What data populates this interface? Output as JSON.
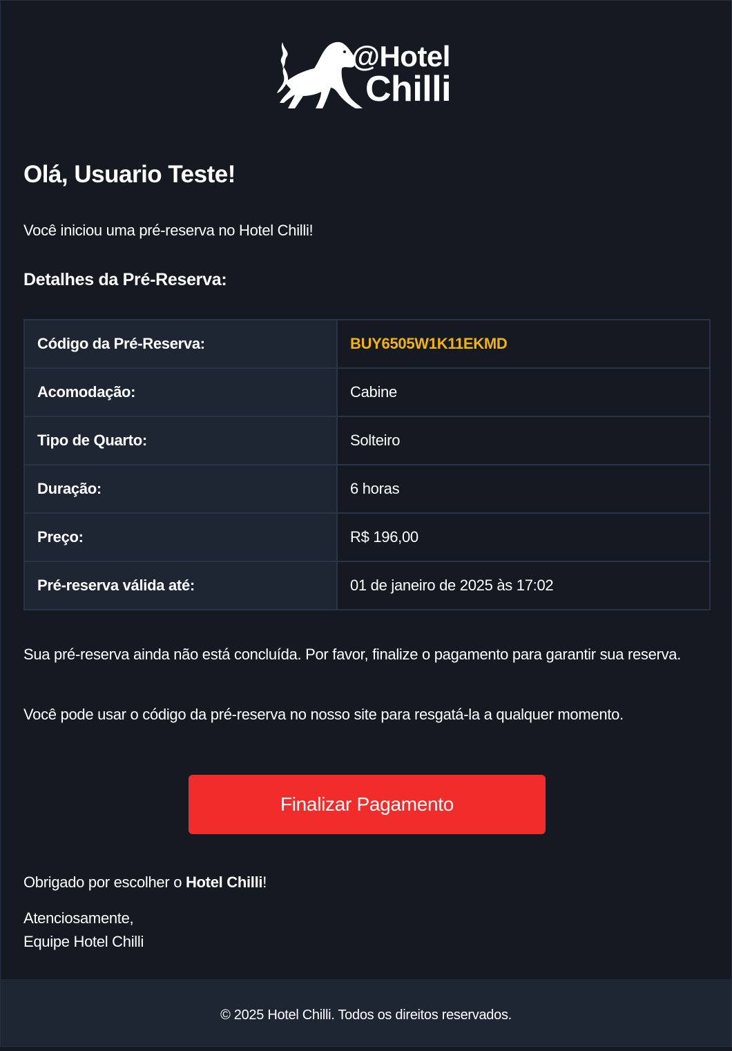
{
  "brand": {
    "logo_line1": "@Hotel",
    "logo_line2": "Chilli"
  },
  "greeting": "Olá, Usuario Teste!",
  "intro": "Você iniciou uma pré-reserva no Hotel Chilli!",
  "details_title": "Detalhes da Pré-Reserva:",
  "details": [
    {
      "label": "Código da Pré-Reserva:",
      "value": "BUY6505W1K11EKMD"
    },
    {
      "label": "Acomodação:",
      "value": "Cabine"
    },
    {
      "label": "Tipo de Quarto:",
      "value": "Solteiro"
    },
    {
      "label": "Duração:",
      "value": "6 horas"
    },
    {
      "label": "Preço:",
      "value": "R$ 196,00"
    },
    {
      "label": "Pré-reserva válida até:",
      "value": "01 de janeiro de 2025 às 17:02"
    }
  ],
  "note_pending": "Sua pré-reserva ainda não está concluída. Por favor, finalize o pagamento para garantir sua reserva.",
  "note_code": "Você pode usar o código da pré-reserva no nosso site para resgatá-la a qualquer momento.",
  "pay_button_label": "Finalizar Pagamento",
  "thanks_prefix": "Obrigado por escolher o ",
  "thanks_brand": "Hotel Chilli",
  "thanks_suffix": "!",
  "signoff_line1": "Atenciosamente,",
  "signoff_line2": "Equipe Hotel Chilli",
  "footer": "© 2025 Hotel Chilli. Todos os direitos reservados.",
  "colors": {
    "background": "#151a22",
    "table_label_bg": "#1f2633",
    "code_highlight": "#f2b30c",
    "button": "#f22b2b",
    "footer_bg": "#1f2633"
  },
  "icons": {
    "logo": "panther-with-flame-tail-icon"
  }
}
